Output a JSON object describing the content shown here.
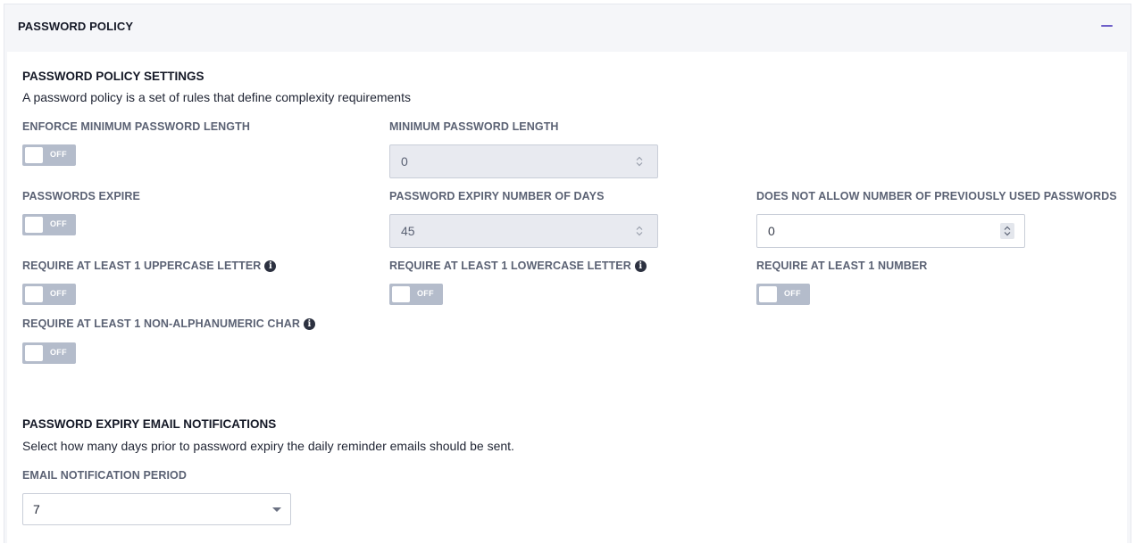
{
  "panel": {
    "title": "PASSWORD POLICY"
  },
  "settings": {
    "title": "PASSWORD POLICY SETTINGS",
    "description": "A password policy is a set of rules that define complexity requirements",
    "enforce_min_length": {
      "label": "ENFORCE MINIMUM PASSWORD LENGTH",
      "state": "OFF"
    },
    "min_length": {
      "label": "MINIMUM PASSWORD LENGTH",
      "value": "0"
    },
    "passwords_expire": {
      "label": "PASSWORDS EXPIRE",
      "state": "OFF"
    },
    "expiry_days": {
      "label": "PASSWORD EXPIRY NUMBER OF DAYS",
      "value": "45"
    },
    "history": {
      "label": "DOES NOT ALLOW NUMBER OF PREVIOUSLY USED PASSWORDS",
      "value": "0"
    },
    "uppercase": {
      "label": "REQUIRE AT LEAST 1 UPPERCASE LETTER",
      "state": "OFF"
    },
    "lowercase": {
      "label": "REQUIRE AT LEAST 1 LOWERCASE LETTER",
      "state": "OFF"
    },
    "number": {
      "label": "REQUIRE AT LEAST 1 NUMBER",
      "state": "OFF"
    },
    "non_alphanumeric": {
      "label": "REQUIRE AT LEAST 1 NON-ALPHANUMERIC CHAR",
      "state": "OFF"
    }
  },
  "notifications": {
    "title": "PASSWORD EXPIRY EMAIL NOTIFICATIONS",
    "description": "Select how many days prior to password expiry the daily reminder emails should be sent.",
    "period": {
      "label": "EMAIL NOTIFICATION PERIOD",
      "value": "7"
    }
  },
  "icons": {
    "info": "info-icon",
    "collapse": "minus-icon",
    "spinner": "up-down-chevron-icon",
    "dropdown": "caret-down-icon"
  },
  "colors": {
    "accent": "#6e5fc9",
    "toggle_off": "#b4bccb",
    "disabled_input": "#e8eaf0",
    "label": "#5b6274"
  }
}
